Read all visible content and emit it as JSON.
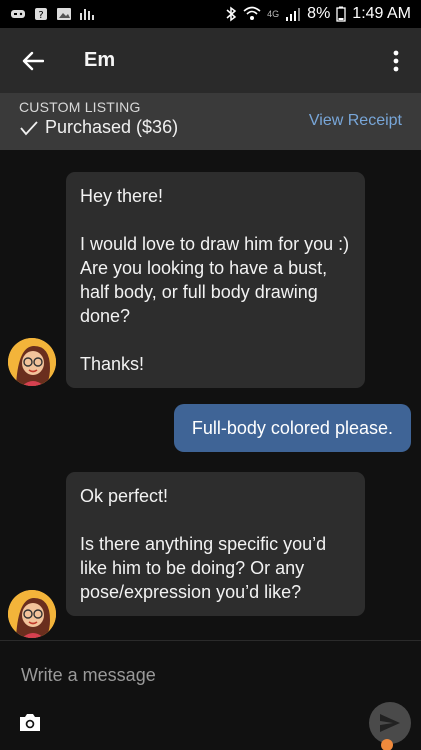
{
  "status_bar": {
    "network_label": "4G",
    "battery": "8%",
    "time": "1:49 AM"
  },
  "header": {
    "back_icon": "arrow-left-icon",
    "title": "Em",
    "more_icon": "more-vertical-icon"
  },
  "listing": {
    "type": "CUSTOM LISTING",
    "status": "Purchased ($36)",
    "view_receipt": "View Receipt",
    "check_icon": "check-icon"
  },
  "messages": [
    {
      "from": "seller",
      "text": "Hey there!\n\nI would love to draw him for you :) Are you looking to have a bust, half body, or full body drawing done?\n\nThanks!"
    },
    {
      "from": "me",
      "text": "Full-body colored please."
    },
    {
      "from": "seller",
      "text": "Ok perfect!\n\nIs there anything specific you’d like him to be doing? Or any pose/expression you’d like?"
    }
  ],
  "composer": {
    "placeholder": "Write a message",
    "camera_icon": "camera-icon",
    "send_icon": "send-icon"
  },
  "colors": {
    "outgoing_bubble": "#3f6496",
    "incoming_bubble": "#2d2d2d",
    "link": "#78a6d8"
  }
}
